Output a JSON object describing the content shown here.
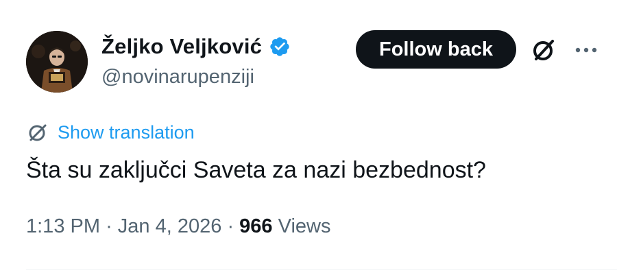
{
  "author": {
    "display_name": "Željko Veljković",
    "handle": "@novinarupenziji",
    "verified": true
  },
  "actions": {
    "follow_label": "Follow back",
    "grok_icon": "grok-icon",
    "more_icon": "more-icon"
  },
  "translation": {
    "label": "Show translation"
  },
  "tweet": {
    "text": "Šta su zaključci Saveta za nazi bezbednost?"
  },
  "meta": {
    "time": "1:13 PM",
    "separator": "·",
    "date": "Jan 4, 2026",
    "view_count": "966",
    "views_label": "Views"
  },
  "colors": {
    "accent": "#1d9bf0",
    "text": "#0f1419",
    "secondary": "#536471",
    "button_bg": "#0f1419"
  }
}
